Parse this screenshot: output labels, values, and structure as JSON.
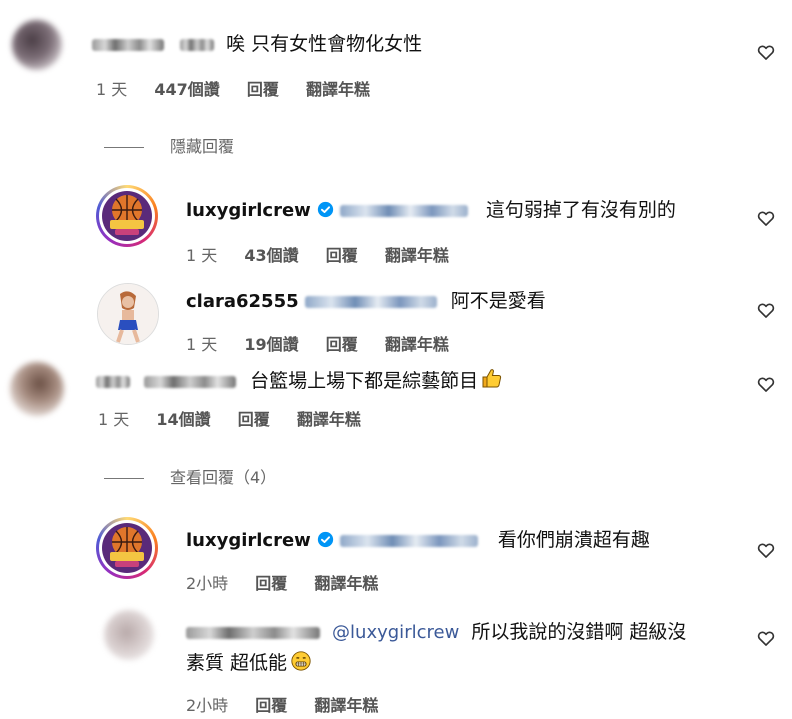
{
  "comments": [
    {
      "text": "唉 只有女性會物化女性",
      "time": "1 天",
      "likes": "447個讚",
      "reply_label": "回覆",
      "translate_label": "翻譯年糕"
    }
  ],
  "toggle_hide": "隱藏回覆",
  "replies": [
    {
      "username": "luxygirlcrew",
      "text": "這句弱掉了有沒有別的",
      "time": "1 天",
      "likes": "43個讚",
      "reply_label": "回覆",
      "translate_label": "翻譯年糕"
    },
    {
      "username": "clara62555",
      "text": "阿不是愛看",
      "time": "1 天",
      "likes": "19個讚",
      "reply_label": "回覆",
      "translate_label": "翻譯年糕"
    }
  ],
  "comment2": {
    "text": "台籃場上場下都是綜藝節目",
    "time": "1 天",
    "likes": "14個讚",
    "reply_label": "回覆",
    "translate_label": "翻譯年糕"
  },
  "toggle_view": "查看回覆（4）",
  "replies2": [
    {
      "username": "luxygirlcrew",
      "text": "看你們崩潰超有趣",
      "time": "2小時",
      "reply_label": "回覆",
      "translate_label": "翻譯年糕"
    },
    {
      "mention": "@luxygirlcrew",
      "text_a": "所以我說的沒錯啊 超級沒",
      "text_b": "素質 超低能",
      "time": "2小時",
      "reply_label": "回覆",
      "translate_label": "翻譯年糕"
    }
  ],
  "colors": {
    "brand_ring": "#d62976",
    "verified": "#0095f6",
    "text": "#111111",
    "meta": "#666666"
  }
}
